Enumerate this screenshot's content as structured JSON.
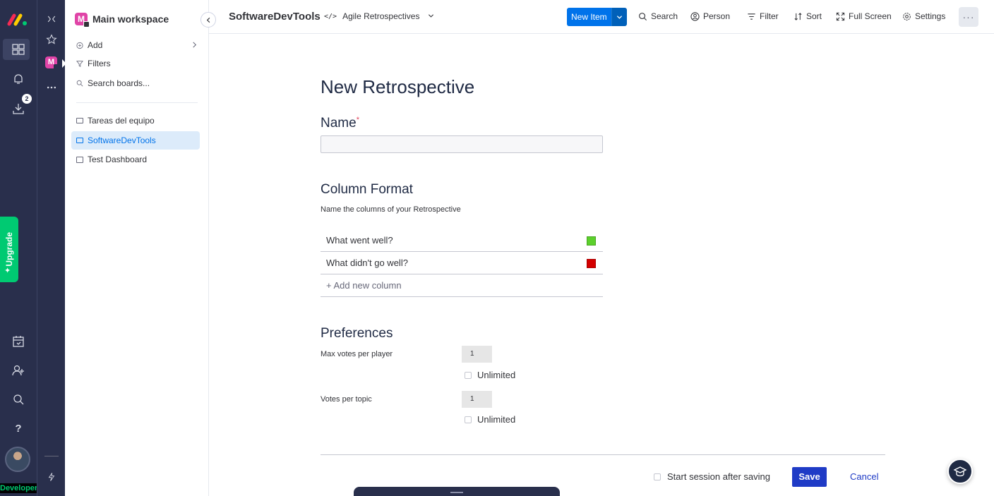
{
  "rail": {
    "notification_badge": "2",
    "upgrade_label": "Upgrade",
    "developer_label": "Developer"
  },
  "workspace": {
    "title": "Main workspace",
    "avatar_letter": "M",
    "actions": [
      {
        "label": "Add"
      },
      {
        "label": "Filters"
      },
      {
        "label": "Search boards..."
      }
    ],
    "boards": [
      {
        "label": "Tareas del equipo"
      },
      {
        "label": "SoftwareDevTools"
      },
      {
        "label": "Test Dashboard"
      }
    ]
  },
  "header": {
    "board_title": "SoftwareDevTools",
    "app_name": "Agile Retrospectives",
    "app_code_icon": "</>",
    "new_item_label": "New Item",
    "buttons": [
      {
        "label": "Search"
      },
      {
        "label": "Person"
      },
      {
        "label": "Filter"
      },
      {
        "label": "Sort"
      },
      {
        "label": "Full Screen"
      },
      {
        "label": "Settings"
      }
    ],
    "more_label": "···"
  },
  "form": {
    "title": "New Retrospective",
    "name_label": "Name",
    "required_mark": "*",
    "name_value": "",
    "column_format_title": "Column Format",
    "column_format_hint": "Name the columns of your Retrospective",
    "columns": [
      {
        "label": "What went well?",
        "color": "#5cd02c"
      },
      {
        "label": "What didn't go well?",
        "color": "#d40000"
      }
    ],
    "add_column_label": "+ Add new column",
    "preferences_title": "Preferences",
    "preferences": [
      {
        "label": "Max votes per player",
        "value": "1",
        "unlimited_label": "Unlimited",
        "unlimited": false
      },
      {
        "label": "Votes per topic",
        "value": "1",
        "unlimited_label": "Unlimited",
        "unlimited": false
      }
    ],
    "start_session_label": "Start session after saving",
    "save_label": "Save",
    "cancel_label": "Cancel"
  },
  "colors": {
    "rail": "#292f4c",
    "accent": "#0073ea",
    "save": "#1f3bc6",
    "upgrade": "#00ca72"
  }
}
